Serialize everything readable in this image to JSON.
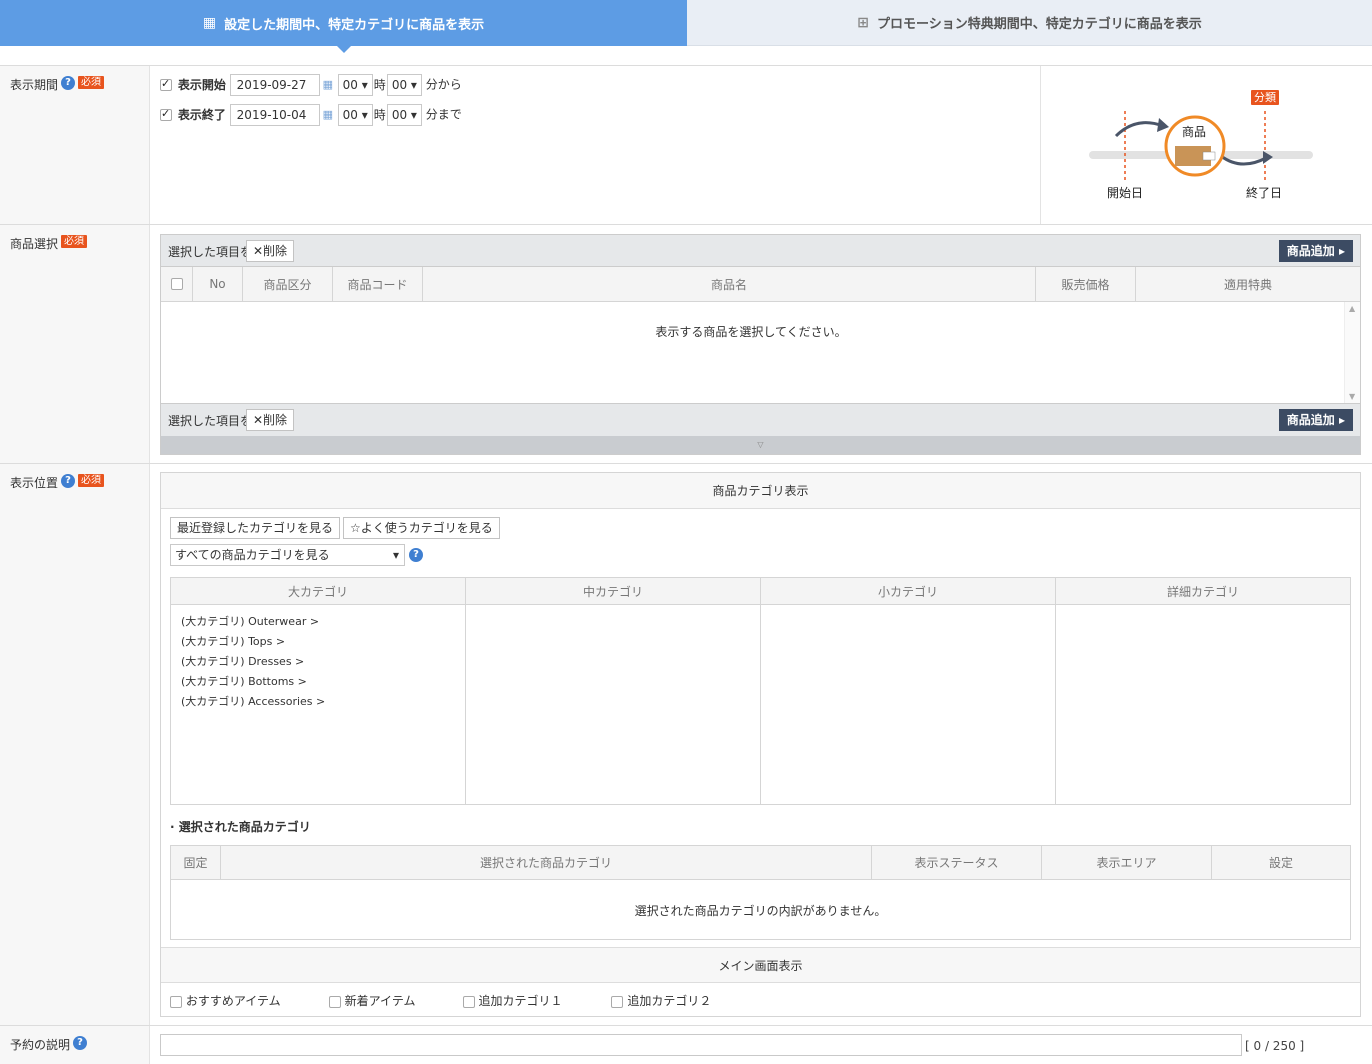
{
  "tabs": [
    {
      "label": "設定した期間中、特定カテゴリに商品を表示",
      "icon": "calendar-icon",
      "active": true
    },
    {
      "label": "プロモーション特典期間中、特定カテゴリに商品を表示",
      "icon": "gift-icon",
      "active": false
    }
  ],
  "period": {
    "label": "表示期間",
    "required": "必須",
    "start_label": "表示開始",
    "start_date": "2019-09-27",
    "start_hour": "00",
    "start_min": "00",
    "start_suffix": "分から",
    "end_label": "表示終了",
    "end_date": "2019-10-04",
    "end_hour": "00",
    "end_min": "00",
    "end_suffix": "分まで",
    "hour_unit": "時",
    "diagram": {
      "product": "商品",
      "category": "分類",
      "start": "開始日",
      "end": "終了日"
    }
  },
  "product_select": {
    "label": "商品選択",
    "required": "必須",
    "selected_text": "選択した項目を",
    "delete_label": "✕削除",
    "add_label": "商品追加",
    "columns": [
      "No",
      "商品区分",
      "商品コード",
      "商品名",
      "販売価格",
      "適用特典"
    ],
    "empty_message": "表示する商品を選択してください。"
  },
  "position": {
    "label": "表示位置",
    "required": "必須",
    "section_title": "商品カテゴリ表示",
    "recent_btn": "最近登録したカテゴリを見る",
    "fav_btn": "☆よく使うカテゴリを見る",
    "select_value": "すべての商品カテゴリを見る",
    "category_columns": [
      "大カテゴリ",
      "中カテゴリ",
      "小カテゴリ",
      "詳細カテゴリ"
    ],
    "large_categories": [
      "(大カテゴリ) Outerwear >",
      "(大カテゴリ) Tops >",
      "(大カテゴリ) Dresses >",
      "(大カテゴリ) Bottoms >",
      "(大カテゴリ) Accessories >"
    ],
    "selected_title": "選択された商品カテゴリ",
    "selected_columns": [
      "固定",
      "選択された商品カテゴリ",
      "表示ステータス",
      "表示エリア",
      "設定"
    ],
    "selected_empty": "選択された商品カテゴリの内訳がありません。",
    "main_title": "メイン画面表示",
    "main_options": [
      "おすすめアイテム",
      "新着アイテム",
      "追加カテゴリ１",
      "追加カテゴリ２"
    ]
  },
  "reservation": {
    "label": "予約の説明",
    "counter": "[ 0 / 250 ]"
  }
}
